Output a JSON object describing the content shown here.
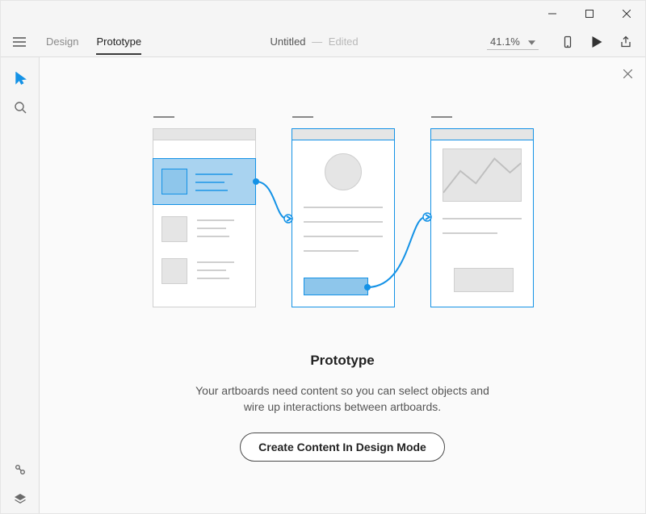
{
  "window": {
    "minimize": "Minimize",
    "maximize": "Maximize",
    "close": "Close"
  },
  "toolbar": {
    "tab_design": "Design",
    "tab_prototype": "Prototype",
    "doc_title": "Untitled",
    "doc_status_sep": "—",
    "doc_status": "Edited",
    "zoom": "41.1%"
  },
  "left_rail": {
    "select": "Select",
    "zoom": "Zoom",
    "plugins": "Plugins",
    "layers": "Layers"
  },
  "empty_state": {
    "heading": "Prototype",
    "line1": "Your artboards need content so you can select objects and",
    "line2": "wire up interactions between artboards.",
    "cta": "Create Content In Design Mode"
  }
}
